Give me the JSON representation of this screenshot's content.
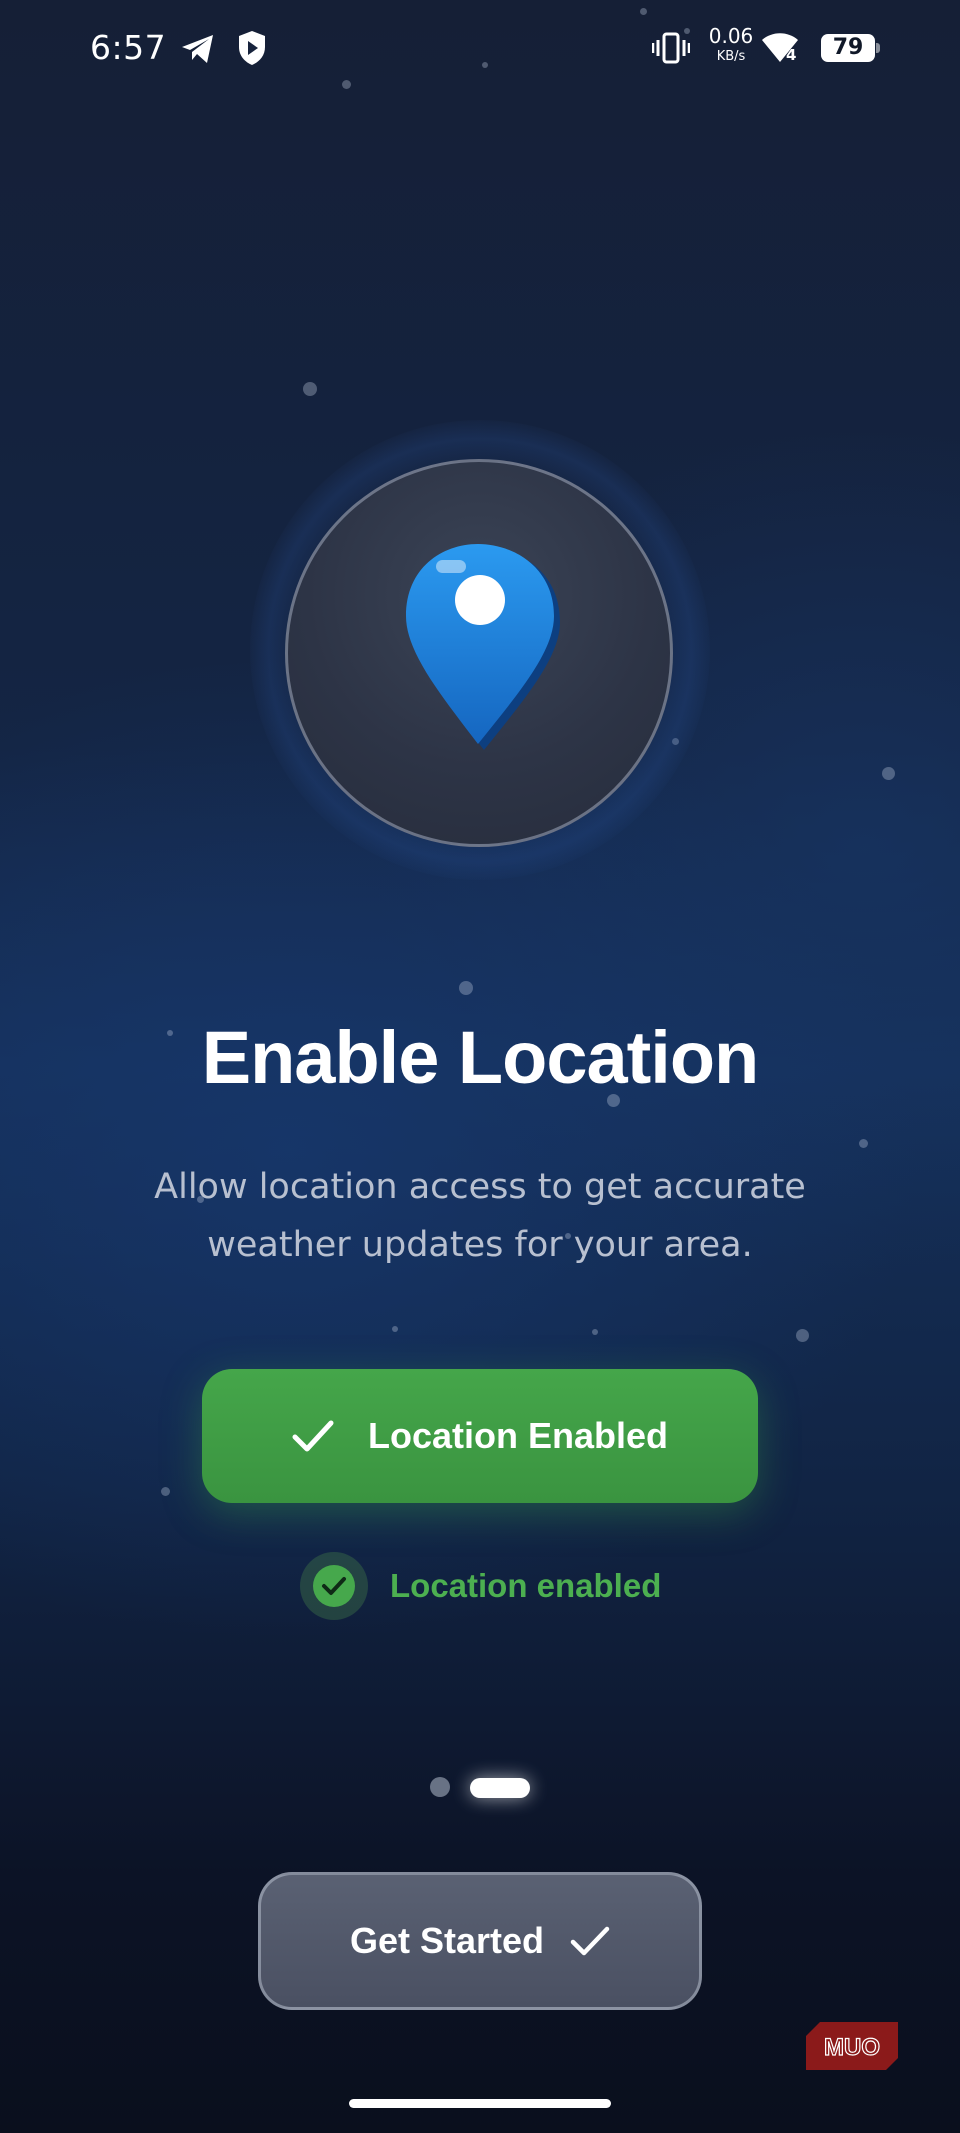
{
  "status_bar": {
    "time": "6:57",
    "net_speed_value": "0.06",
    "net_speed_unit": "KB/s",
    "wifi_level": "4",
    "battery_level": "79",
    "icons": [
      "telegram-icon",
      "shield-play-icon",
      "vibrate-icon",
      "wifi-icon",
      "battery-icon"
    ]
  },
  "hero": {
    "icon": "location-pin-icon",
    "title": "Enable Location",
    "description_line1": "Allow location access to get accurate",
    "description_line2": "weather updates for your area."
  },
  "primary_button": {
    "label": "Location Enabled",
    "icon": "checkmark-icon",
    "color": "#43a047"
  },
  "status": {
    "text": "Location enabled",
    "icon": "check-circle-icon",
    "color": "#4caf50"
  },
  "pagination": {
    "total": 2,
    "current": 2
  },
  "secondary_button": {
    "label": "Get Started",
    "icon": "checkmark-icon"
  },
  "watermark": {
    "text": "MUO",
    "color": "#8b1a1a"
  },
  "colors": {
    "background_top": "#151f36",
    "background_mid": "#15305a",
    "background_bottom": "#0a0f1d",
    "pin_blue": "#1e88e5",
    "description": "#b8c0d0"
  }
}
